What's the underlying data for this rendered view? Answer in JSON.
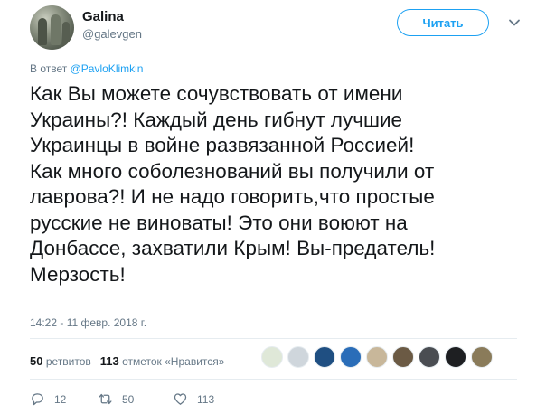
{
  "user": {
    "name": "Galina",
    "handle": "@galevgen"
  },
  "follow_button": "Читать",
  "reply": {
    "prefix": "В ответ",
    "mention": "@PavloKlimkin"
  },
  "tweet": {
    "lines": [
      "Как Вы можете сочувствовать от имени",
      "Украины?! Каждый день гибнут лучшие",
      "Украинцы в войне развязанной Россией!",
      "Как много соболезнований вы получили от",
      "лаврова?! И не надо говорить,что простые",
      "русские не виноваты! Это они воюют на",
      "Донбассе, захватили Крым! Вы-предатель!",
      "Мерзость!"
    ]
  },
  "timestamp": "14:22 - 11 февр. 2018 г.",
  "stats": {
    "retweets_count": "50",
    "retweets_label": "ретвитов",
    "likes_count": "113",
    "likes_label": "отметок «Нравится»"
  },
  "likers": [
    {
      "color": "#dfe8d8"
    },
    {
      "color": "#cfd6dc"
    },
    {
      "color": "#1f4f82"
    },
    {
      "color": "#2a6db8"
    },
    {
      "color": "#c8b79a"
    },
    {
      "color": "#6b5a44"
    },
    {
      "color": "#4a4d52"
    },
    {
      "color": "#1e1f22"
    },
    {
      "color": "#8a7b5a"
    }
  ],
  "actions": {
    "replies": "12",
    "retweets": "50",
    "likes": "113"
  },
  "colors": {
    "accent": "#1da1f2",
    "muted": "#657786",
    "text": "#14171a",
    "retweet_green": "#17bf63"
  }
}
